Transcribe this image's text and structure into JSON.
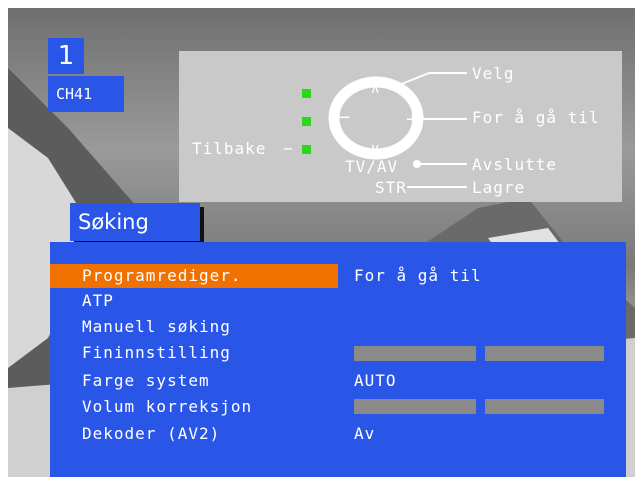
{
  "channel": {
    "number": "1",
    "label": "CH41"
  },
  "remote_help": {
    "select": "Velg",
    "go_to": "For å gå til",
    "back": "Tilbake",
    "tv_av": "TV/AV",
    "exit": "Avslutte",
    "str": "STR",
    "store": "Lagre"
  },
  "menu": {
    "title": "Søking",
    "items": [
      {
        "label": "Programrediger.",
        "value": "For å gå til",
        "selected": true
      },
      {
        "label": "ATP",
        "value": ""
      },
      {
        "label": "Manuell søking",
        "value": ""
      },
      {
        "label": "Fininnstilling",
        "value": ""
      },
      {
        "label": "Farge system",
        "value": "AUTO"
      },
      {
        "label": "Volum korreksjon",
        "value": ""
      },
      {
        "label": "Dekoder (AV2)",
        "value": "Av"
      }
    ]
  },
  "colors": {
    "menu_blue": "#2a56e8",
    "selected_orange": "#f07000",
    "indicator_green": "#27d81b"
  }
}
